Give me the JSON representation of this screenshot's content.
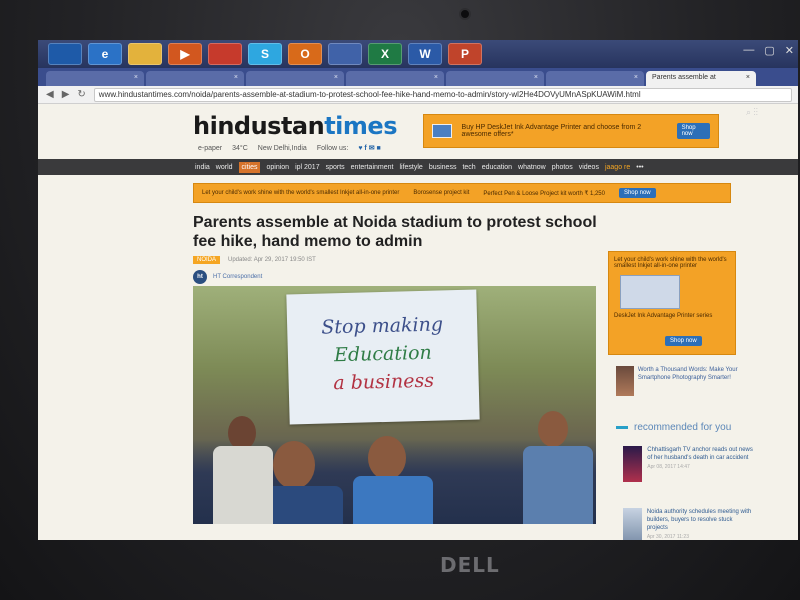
{
  "device": {
    "brand": "DELL"
  },
  "taskbar": {
    "apps": [
      {
        "icon": "windows-start-icon",
        "label": "",
        "color": "#1e5aa8"
      },
      {
        "icon": "ie-icon",
        "label": "e",
        "color": "#2b72c6"
      },
      {
        "icon": "folder-icon",
        "label": "",
        "color": "#e3b23c"
      },
      {
        "icon": "media-player-icon",
        "label": "▶",
        "color": "#d2571f"
      },
      {
        "icon": "chrome-icon",
        "label": "",
        "color": "#c63a2c"
      },
      {
        "icon": "skype-icon",
        "label": "S",
        "color": "#2ea7e0"
      },
      {
        "icon": "outlook-icon",
        "label": "O",
        "color": "#d86a1a"
      },
      {
        "icon": "unknown-app-icon",
        "label": "",
        "color": "#4062a8"
      },
      {
        "icon": "excel-icon",
        "label": "X",
        "color": "#1f7a44"
      },
      {
        "icon": "word-icon",
        "label": "W",
        "color": "#2b5aa7"
      },
      {
        "icon": "powerpoint-icon",
        "label": "P",
        "color": "#c0442b"
      }
    ]
  },
  "browser": {
    "tabs": [
      {
        "label": ""
      },
      {
        "label": ""
      },
      {
        "label": ""
      },
      {
        "label": ""
      },
      {
        "label": ""
      },
      {
        "label": ""
      },
      {
        "label": "Parents assemble at",
        "active": true
      }
    ],
    "url": "www.hindustantimes.com/noida/parents-assemble-at-stadium-to-protest-school-fee-hike-hand-memo-to-admin/story-wl2He4DOVyUMnASpKUAWiM.html"
  },
  "header": {
    "logo_a": "hindustan",
    "logo_b": "times",
    "epaper": "e-paper",
    "temperature": "34°C",
    "city": "New Delhi,India",
    "follow_label": "Follow us:",
    "social_icons": "♥ f ✉ ■"
  },
  "ads": {
    "top_text": "Buy HP DeskJet Ink Advantage Printer and choose from 2 awesome offers*",
    "top_btn": "Shop now",
    "strip_text_1": "Let your child's work shine with the world's smallest Inkjet all-in-one printer",
    "strip_text_2": "Borosense project kit",
    "strip_text_3": "Perfect Pen & Loose Project kit worth ₹ 1,250",
    "strip_btn": "Shop now",
    "side_text": "Let your child's work shine with the world's smallest Inkjet all-in-one printer",
    "side_sub": "DeskJet Ink Advantage Printer series",
    "side_btn": "Shop now"
  },
  "nav": {
    "items": [
      {
        "label": "india"
      },
      {
        "label": "world"
      },
      {
        "label": "cities",
        "highlight": true
      },
      {
        "label": "opinion"
      },
      {
        "label": "ipl 2017"
      },
      {
        "label": "sports"
      },
      {
        "label": "entertainment"
      },
      {
        "label": "lifestyle"
      },
      {
        "label": "business"
      },
      {
        "label": "tech"
      },
      {
        "label": "education"
      },
      {
        "label": "whatnow"
      },
      {
        "label": "photos"
      },
      {
        "label": "videos"
      },
      {
        "label": "jaago re",
        "orange": true
      },
      {
        "label": "•••"
      }
    ]
  },
  "article": {
    "headline": "Parents assemble at Noida stadium to protest school fee hike, hand memo to admin",
    "section": "NOIDA",
    "updated": "Updated: Apr 29, 2017 19:50 IST",
    "author_initials": "ht",
    "author": "HT Correspondent",
    "photo_sign": [
      "Stop making",
      "Education",
      "a business"
    ]
  },
  "sidebar": {
    "promo_text": "Worth a Thousand Words: Make Your Smartphone Photography Smarter!",
    "recommended_title": "recommended for you",
    "items": [
      {
        "text": "Chhattisgarh TV anchor reads out news of her husband's death in car accident",
        "date": "Apr 08, 2017 14:47"
      },
      {
        "text": "Noida authority schedules meeting with builders, buyers to resolve stuck projects",
        "date": "Apr 30, 2017 11:23"
      }
    ]
  }
}
